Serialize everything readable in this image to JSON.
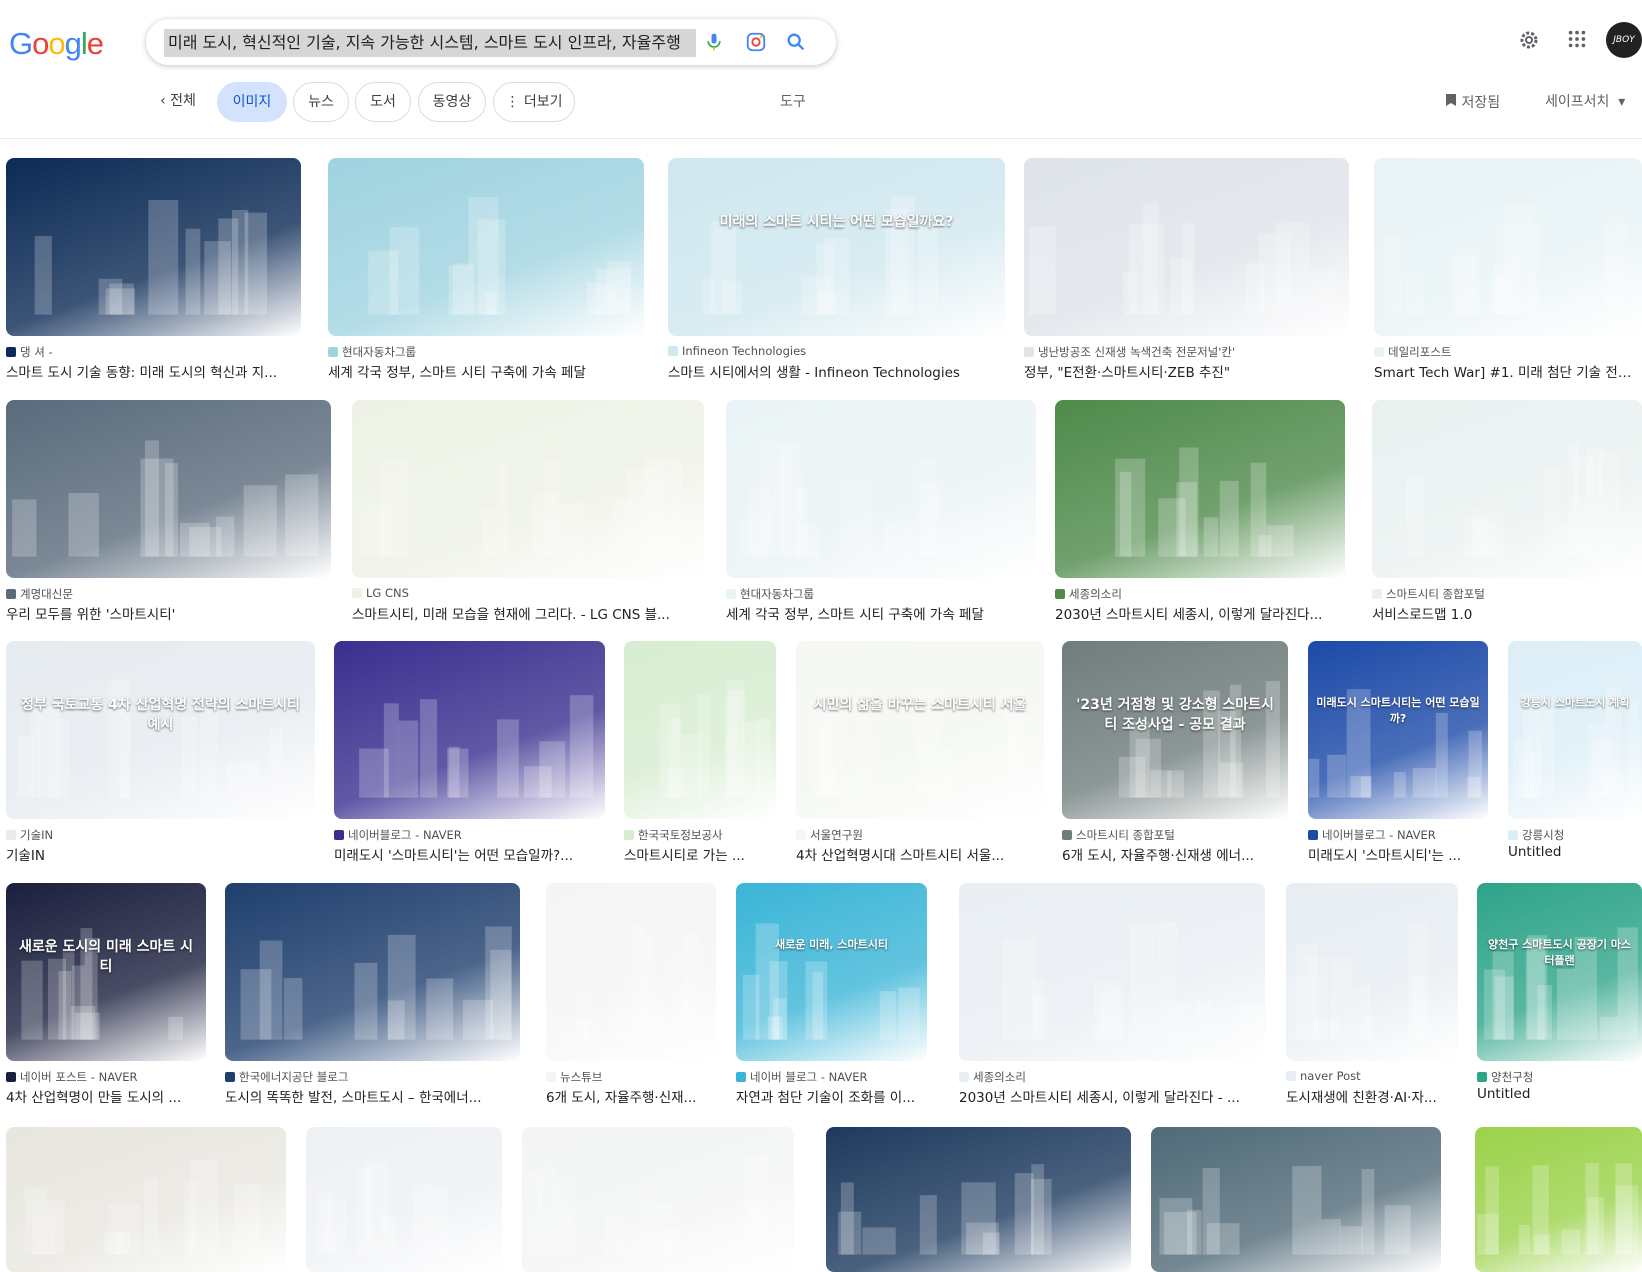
{
  "logo": "Google",
  "search": {
    "query": "미래 도시, 혁신적인 기술, 지속 가능한 시스템, 스마트 도시 인프라, 자율주행"
  },
  "tabs": [
    "전체",
    "이미지",
    "뉴스",
    "도서",
    "동영상",
    "더보기"
  ],
  "tools_label": "도구",
  "saved_label": "저장됨",
  "safesearch_label": "세이프서치",
  "avatar_text": "JBOY",
  "results": [
    {
      "source": "댕 셔 -",
      "title": "스마트 도시 기술 동향: 미래 도시의 혁신과 지...",
      "color": "#0b2a55"
    },
    {
      "source": "현대자동차그룹",
      "title": "세계 각국 정부, 스마트 시티 구축에 가속 페달",
      "color": "#9fd3e0"
    },
    {
      "source": "Infineon Technologies",
      "title": "스마트 시티에서의 생활 - Infineon Technologies",
      "color": "#cfe7ef",
      "overlay": "미래의 스마트 시티는 어떤 모습일까요?"
    },
    {
      "source": "냉난방공조 신재생 녹색건축 전문저널'칸'",
      "title": "정부, \"E전환·스마트시티·ZEB 추진\"",
      "color": "#dfe4ea"
    },
    {
      "source": "데일리포스트",
      "title": "Smart Tech War] #1. 미래 첨단 기술 전쟁 ...",
      "color": "#e8f3f6"
    },
    {
      "source": "계명대신문",
      "title": "우리 모두를 위한 '스마트시티'",
      "color": "#5a6b7c"
    },
    {
      "source": "LG CNS",
      "title": "스마트시티, 미래 모습을 현재에 그리다. - LG CNS 블...",
      "color": "#eef2e6"
    },
    {
      "source": "현대자동차그룹",
      "title": "세계 각국 정부, 스마트 시티 구축에 가속 페달",
      "color": "#eaf3f5"
    },
    {
      "source": "세종의소리",
      "title": "2030년 스마트시티 세종시, 이렇게 달라진다...",
      "color": "#4e8a4a"
    },
    {
      "source": "스마트시티 종합포털",
      "title": "서비스로드맵 1.0",
      "color": "#e9f1f0"
    },
    {
      "source": "기술IN",
      "title": "기술IN",
      "color": "#e6ebf0",
      "overlay": "정부 국토교통 4차 산업혁명 전략의 스마트시티 예시"
    },
    {
      "source": "네이버블로그 - NAVER",
      "title": "미래도시 '스마트시티'는 어떤 모습일까?...",
      "color": "#3a2f8f"
    },
    {
      "source": "한국국토정보공사",
      "title": "스마트시티로 가는 ...",
      "color": "#d7edd1"
    },
    {
      "source": "서울연구원",
      "title": "4차 산업혁명시대 스마트시티 서울...",
      "color": "#f4f7f2",
      "overlay": "시민의 삶을 바꾸는 스마트시티 서울"
    },
    {
      "source": "스마트시티 종합포털",
      "title": "6개 도시, 자율주행·신재생 에너...",
      "color": "#6f7d7c",
      "overlay": "'23년 거점형 및 강소형 스마트시티 조성사업 - 공모 결과"
    },
    {
      "source": "네이버블로그 - NAVER",
      "title": "미래도시 '스마트시티'는 ...",
      "color": "#1c4aa8",
      "overlay": "미래도시 스마트시티는 어떤 모습일까?"
    },
    {
      "source": "강릉시청",
      "title": "Untitled",
      "color": "#dceef7",
      "overlay": "강릉시 스마트도시 계획"
    },
    {
      "source": "네이버 포스트 - NAVER",
      "title": "4차 산업혁명이 만들 도시의 ...",
      "color": "#1a1f3d",
      "overlay": "새로운 도시의 미래 스마트 시티"
    },
    {
      "source": "한국에너지공단 블로그",
      "title": "도시의 똑똑한 발전, 스마트도시 – 한국에너...",
      "color": "#1f3f6e"
    },
    {
      "source": "뉴스튜브",
      "title": "6개 도시, 자율주행·신재...",
      "color": "#f5f5f5"
    },
    {
      "source": "네이버 블로그 - NAVER",
      "title": "자연과 첨단 기술이 조화를 이...",
      "color": "#3bb5d7",
      "overlay": "새로운 미래, 스마트시티"
    },
    {
      "source": "세종의소리",
      "title": "2030년 스마트시티 세종시, 이렇게 달라진다 - ...",
      "color": "#e9eef3"
    },
    {
      "source": "naver Post",
      "title": "도시재생에 친환경·AI·자...",
      "color": "#e7edf2"
    },
    {
      "source": "양천구청",
      "title": "Untitled",
      "color": "#2ea489",
      "overlay": "양천구 스마트도시 공장기 마스터플랜"
    },
    {
      "source": "",
      "title": "",
      "color": "#e8e6df"
    },
    {
      "source": "",
      "title": "",
      "color": "#eef1f4"
    },
    {
      "source": "",
      "title": "",
      "color": "#f3f5f4"
    },
    {
      "source": "",
      "title": "",
      "color": "#1d3a5e"
    },
    {
      "source": "",
      "title": "",
      "color": "#506a78"
    },
    {
      "source": "",
      "title": "",
      "color": "#9bd24a"
    }
  ]
}
